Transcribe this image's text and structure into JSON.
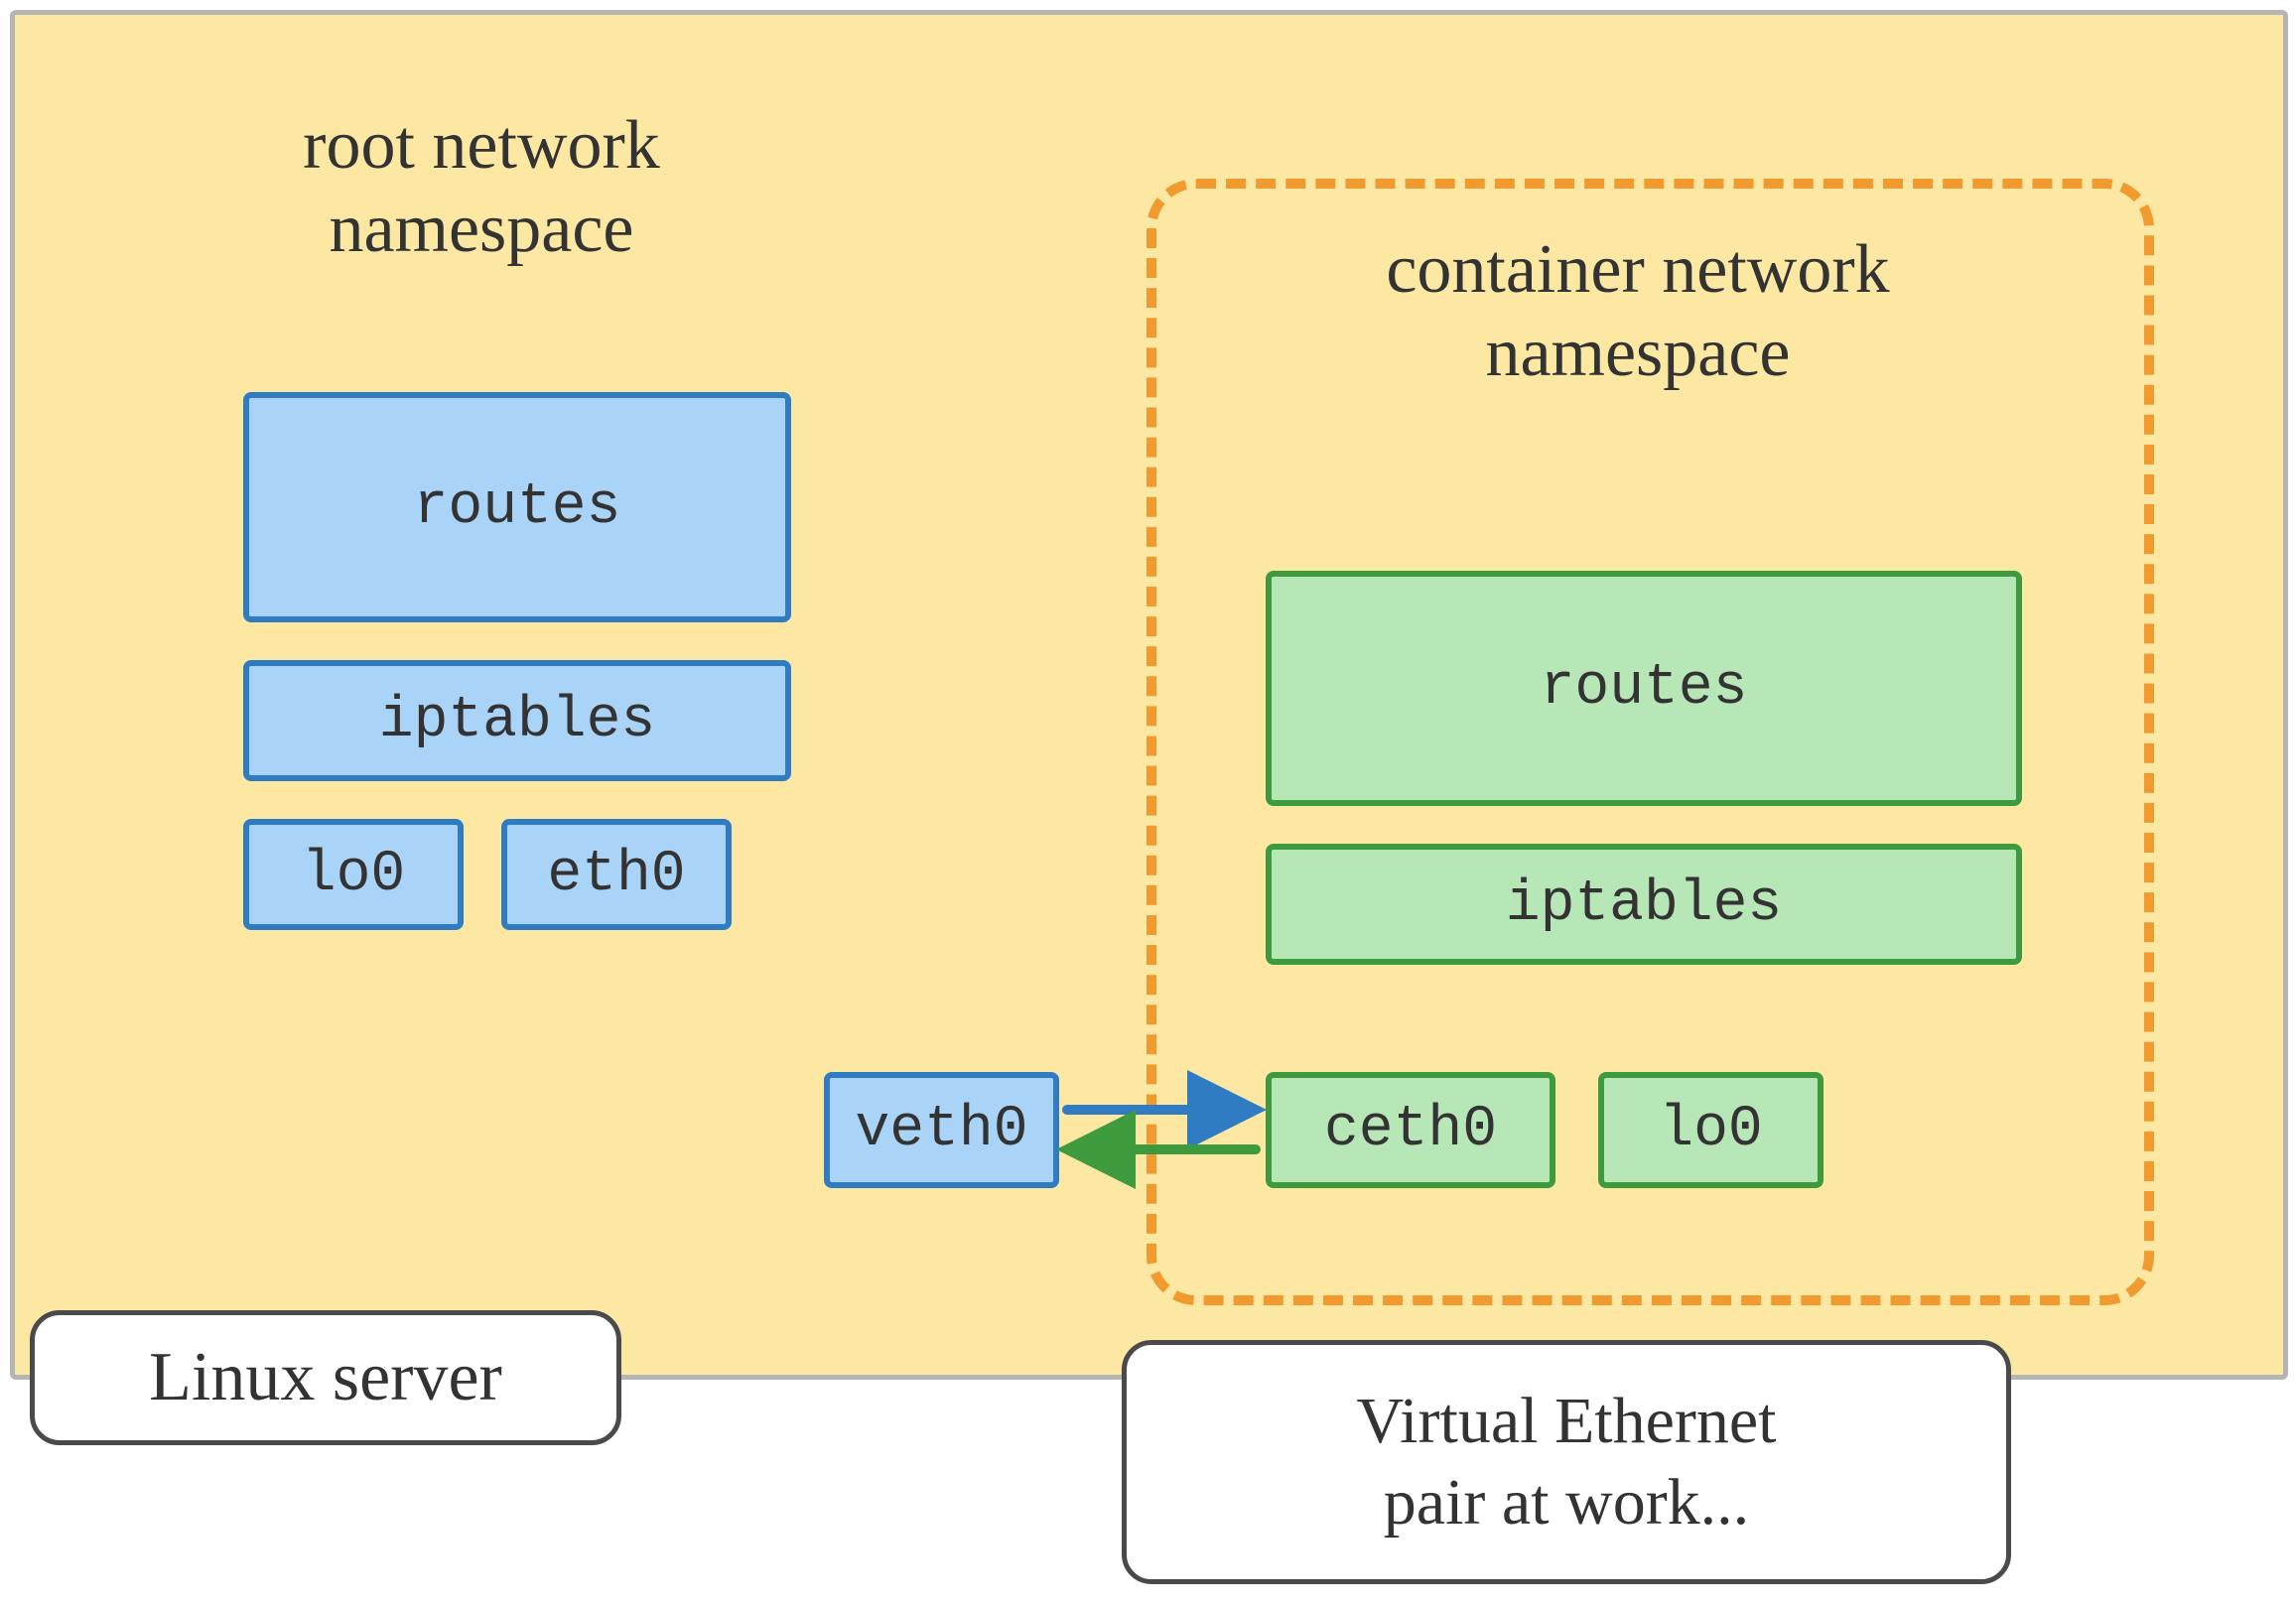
{
  "root_ns": {
    "title": "root network\nnamespace",
    "routes": "routes",
    "iptables": "iptables",
    "lo0": "lo0",
    "eth0": "eth0"
  },
  "container_ns": {
    "title": "container network\nnamespace",
    "routes": "routes",
    "iptables": "iptables",
    "ceth0": "ceth0",
    "lo0": "lo0"
  },
  "link": {
    "veth0": "veth0"
  },
  "callouts": {
    "server": "Linux server",
    "veth_pair": "Virtual Ethernet\npair at work..."
  },
  "colors": {
    "yellow": "#fce8a3",
    "blue_fill": "#aad4f7",
    "blue_stroke": "#2f7cc2",
    "green_fill": "#b7e6b7",
    "green_stroke": "#3d9a3d",
    "orange": "#f09a2f"
  }
}
